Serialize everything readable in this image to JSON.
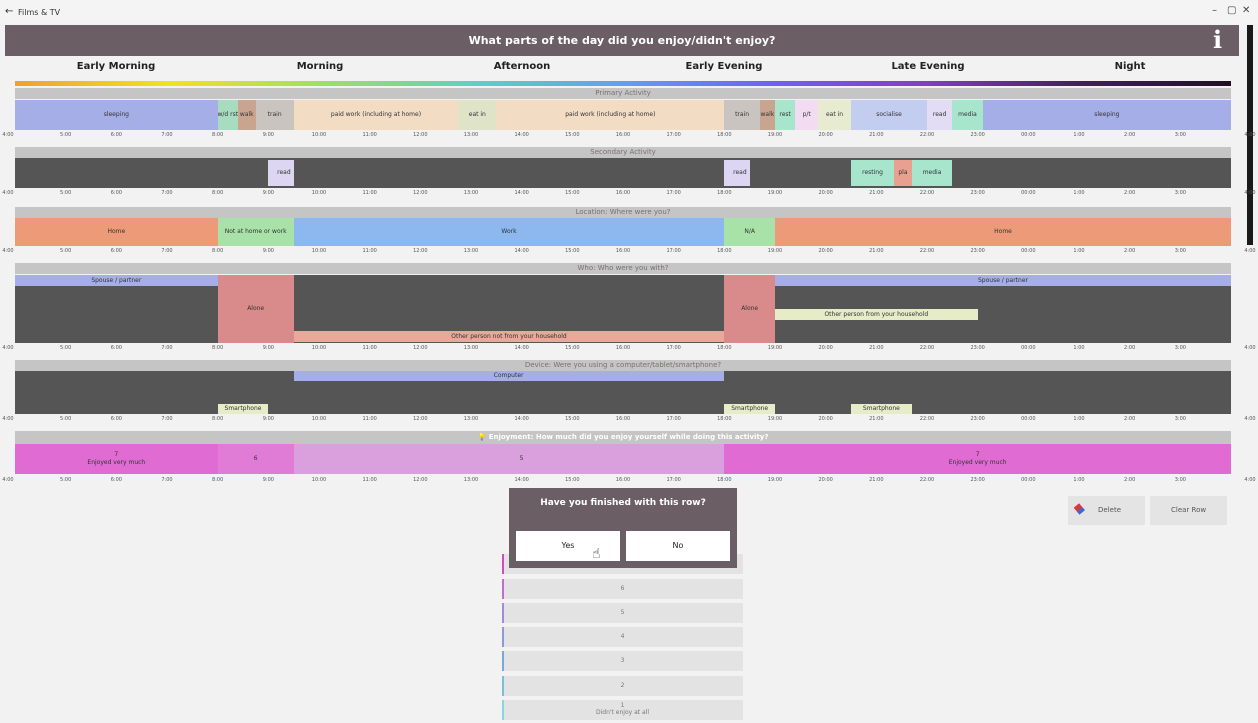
{
  "window": {
    "back_icon": "arrow-left-icon",
    "title": "Films & TV",
    "minimize": "–",
    "restore": "▢",
    "close": "✕"
  },
  "header": {
    "question": "What parts of the day did you enjoy/didn't enjoy?",
    "info_label": "i"
  },
  "periods": [
    "Early Morning",
    "Morning",
    "Afternoon",
    "Early Evening",
    "Late Evening",
    "Night"
  ],
  "ticks": [
    "4:00",
    "5:00",
    "6:00",
    "7:00",
    "8:00",
    "9:00",
    "10:00",
    "11:00",
    "12:00",
    "13:00",
    "14:00",
    "15:00",
    "16:00",
    "17:00",
    "18:00",
    "19:00",
    "20:00",
    "21:00",
    "22:00",
    "23:00",
    "00:00",
    "1:00",
    "2:00",
    "3:00",
    "4:00"
  ],
  "sections": {
    "primary": "Primary Activity",
    "secondary": "Secondary Activity",
    "location": "Location: Where were you?",
    "who": "Who: Who were you with?",
    "device": "Device: Were you using a computer/tablet/smartphone?",
    "enjoyment": "Enjoyment: How much did you enjoy yourself while doing this activity?"
  },
  "primary": [
    {
      "label": "sleeping",
      "start": 4.0,
      "end": 8.0,
      "color": "#a5aee6"
    },
    {
      "label": "w/d rst",
      "start": 8.0,
      "end": 8.4,
      "color": "#a7dcc0"
    },
    {
      "label": "walk",
      "start": 8.4,
      "end": 8.75,
      "color": "#c9a590"
    },
    {
      "label": "train",
      "start": 8.75,
      "end": 9.5,
      "color": "#c9c4bf"
    },
    {
      "label": "paid work (including at home)",
      "start": 9.5,
      "end": 12.75,
      "color": "#f3dcc4"
    },
    {
      "label": "eat in",
      "start": 12.75,
      "end": 13.5,
      "color": "#dfe3c8"
    },
    {
      "label": "paid work (including at home)",
      "start": 13.5,
      "end": 18.0,
      "color": "#f3dcc4"
    },
    {
      "label": "train",
      "start": 18.0,
      "end": 18.7,
      "color": "#c9c4bf"
    },
    {
      "label": "walk",
      "start": 18.7,
      "end": 19.0,
      "color": "#c9a590"
    },
    {
      "label": "rest",
      "start": 19.0,
      "end": 19.4,
      "color": "#a7e6cc"
    },
    {
      "label": "p/t",
      "start": 19.4,
      "end": 19.85,
      "color": "#f2dcf2"
    },
    {
      "label": "eat in",
      "start": 19.85,
      "end": 20.5,
      "color": "#e7ebcf"
    },
    {
      "label": "socialise",
      "start": 20.5,
      "end": 22.0,
      "color": "#c3cdf0"
    },
    {
      "label": "read",
      "start": 22.0,
      "end": 22.5,
      "color": "#e2dcf5"
    },
    {
      "label": "media",
      "start": 22.5,
      "end": 23.1,
      "color": "#a7e6cc"
    },
    {
      "label": "sleeping",
      "start": 23.1,
      "end": 28.0,
      "color": "#a5aee6"
    }
  ],
  "secondary": [
    {
      "label": "read",
      "start": 9.0,
      "end": 9.5,
      "color": "#dcd6f2"
    },
    {
      "label": "read",
      "start": 18.0,
      "end": 18.5,
      "color": "#dcd6f2"
    },
    {
      "label": "resting",
      "start": 20.5,
      "end": 21.35,
      "color": "#a7e6cc"
    },
    {
      "label": "pla",
      "start": 21.35,
      "end": 21.7,
      "color": "#e8a090"
    },
    {
      "label": "media",
      "start": 21.7,
      "end": 22.5,
      "color": "#a7e6cc"
    }
  ],
  "location": [
    {
      "label": "Home",
      "start": 4.0,
      "end": 8.0,
      "color": "#ec9a78"
    },
    {
      "label": "Not at home or work",
      "start": 8.0,
      "end": 9.5,
      "color": "#a9e2a9"
    },
    {
      "label": "Work",
      "start": 9.5,
      "end": 18.0,
      "color": "#8db7ef"
    },
    {
      "label": "N/A",
      "start": 18.0,
      "end": 19.0,
      "color": "#a9e2a9"
    },
    {
      "label": "Home",
      "start": 19.0,
      "end": 28.0,
      "color": "#ec9a78"
    }
  ],
  "who": [
    {
      "label": "Spouse / partner",
      "start": 4.0,
      "end": 8.0,
      "color": "#a5aee6",
      "lane": "top"
    },
    {
      "label": "Alone",
      "start": 8.0,
      "end": 9.5,
      "color": "#d98a8a",
      "lane": "full"
    },
    {
      "label": "Other person not from your household",
      "start": 9.5,
      "end": 18.0,
      "color": "#e8a89a",
      "lane": "bottom"
    },
    {
      "label": "Alone",
      "start": 18.0,
      "end": 19.0,
      "color": "#d98a8a",
      "lane": "full"
    },
    {
      "label": "Spouse / partner",
      "start": 19.0,
      "end": 28.0,
      "color": "#a5aee6",
      "lane": "top"
    },
    {
      "label": "Other person from your household",
      "start": 19.0,
      "end": 23.0,
      "color": "#e6ebc8",
      "lane": "middle"
    }
  ],
  "device": [
    {
      "label": "Computer",
      "start": 9.5,
      "end": 18.0,
      "color": "#a5aee6",
      "lane": "top"
    },
    {
      "label": "Smartphone",
      "start": 8.0,
      "end": 9.0,
      "color": "#e6ebc8",
      "lane": "bottom"
    },
    {
      "label": "Smartphone",
      "start": 18.0,
      "end": 19.0,
      "color": "#e6ebc8",
      "lane": "bottom"
    },
    {
      "label": "Smartphone",
      "start": 20.5,
      "end": 21.7,
      "color": "#e6ebc8",
      "lane": "bottom"
    }
  ],
  "enjoyment": [
    {
      "value": "7",
      "label": "Enjoyed very much",
      "start": 4.0,
      "end": 8.0,
      "color": "#e06bd2"
    },
    {
      "value": "6",
      "label": "",
      "start": 8.0,
      "end": 9.5,
      "color": "#e07bd6"
    },
    {
      "value": "5",
      "label": "",
      "start": 9.5,
      "end": 18.0,
      "color": "#daa0de"
    },
    {
      "value": "7",
      "label": "Enjoyed very much",
      "start": 18.0,
      "end": 28.0,
      "color": "#e06bd2"
    }
  ],
  "dialog": {
    "question": "Have you finished with this row?",
    "yes": "Yes",
    "no": "No"
  },
  "scale": [
    {
      "value": "",
      "label": "Enjoyed very much",
      "color": "#d24bc4"
    },
    {
      "value": "6",
      "label": "",
      "color": "#c46ad0"
    },
    {
      "value": "5",
      "label": "",
      "color": "#a48ad6"
    },
    {
      "value": "4",
      "label": "",
      "color": "#8c9ad8"
    },
    {
      "value": "3",
      "label": "",
      "color": "#7aa8d8"
    },
    {
      "value": "2",
      "label": "",
      "color": "#78c0d8"
    },
    {
      "value": "1",
      "label": "Didn't enjoy at all",
      "color": "#88d6e0"
    }
  ],
  "actions": {
    "delete_label": "Delete",
    "delete_icon": "eraser-icon",
    "clear_label": "Clear Row"
  }
}
